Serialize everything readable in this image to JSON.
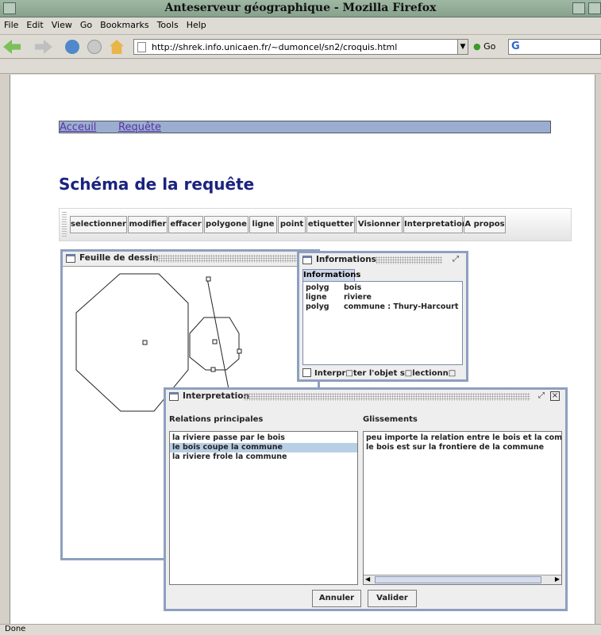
{
  "window": {
    "title": "Anteserveur géographique - Mozilla Firefox"
  },
  "menu": [
    "File",
    "Edit",
    "View",
    "Go",
    "Bookmarks",
    "Tools",
    "Help"
  ],
  "nav": {
    "url": "http://shrek.info.unicaen.fr/~dumoncel/sn2/croquis.html",
    "go_label": "Go",
    "search_glyph": "G"
  },
  "status": {
    "text": "Done"
  },
  "site_nav": {
    "home": "Acceuil",
    "query": "Requête"
  },
  "page": {
    "title": "Schéma de la requête"
  },
  "toolbar": {
    "buttons": [
      "selectionner",
      "modifier",
      "effacer",
      "polygone",
      "ligne",
      "point",
      "etiquetter",
      "Visionner",
      "Interpretation",
      "A propos"
    ]
  },
  "feuille": {
    "title": "Feuille de dessin"
  },
  "informations": {
    "title": "Informations",
    "tab": "Informations",
    "rows": [
      {
        "type": "polyg",
        "name": "bois"
      },
      {
        "type": "ligne",
        "name": "riviere"
      },
      {
        "type": "polyg",
        "name": "commune : Thury-Harcourt"
      }
    ],
    "checkbox_label": "Interpr□ter l'objet s□lectionn□"
  },
  "interpretation": {
    "title": "Interpretation",
    "left_header": "Relations principales",
    "right_header": "Glissements",
    "relations": [
      "la riviere passe par le bois",
      "le bois coupe la commune",
      "la riviere frole la commune"
    ],
    "selected_index": 1,
    "glissements": [
      "peu importe la relation entre  le bois  et  la commu",
      "le bois est sur la frontiere de la commune"
    ],
    "cancel_label": "Annuler",
    "ok_label": "Valider"
  },
  "colors": {
    "link": "#5a33a6",
    "title": "#1a237e",
    "frame_border": "#8ea0bf",
    "selection": "#b8cfe5"
  }
}
